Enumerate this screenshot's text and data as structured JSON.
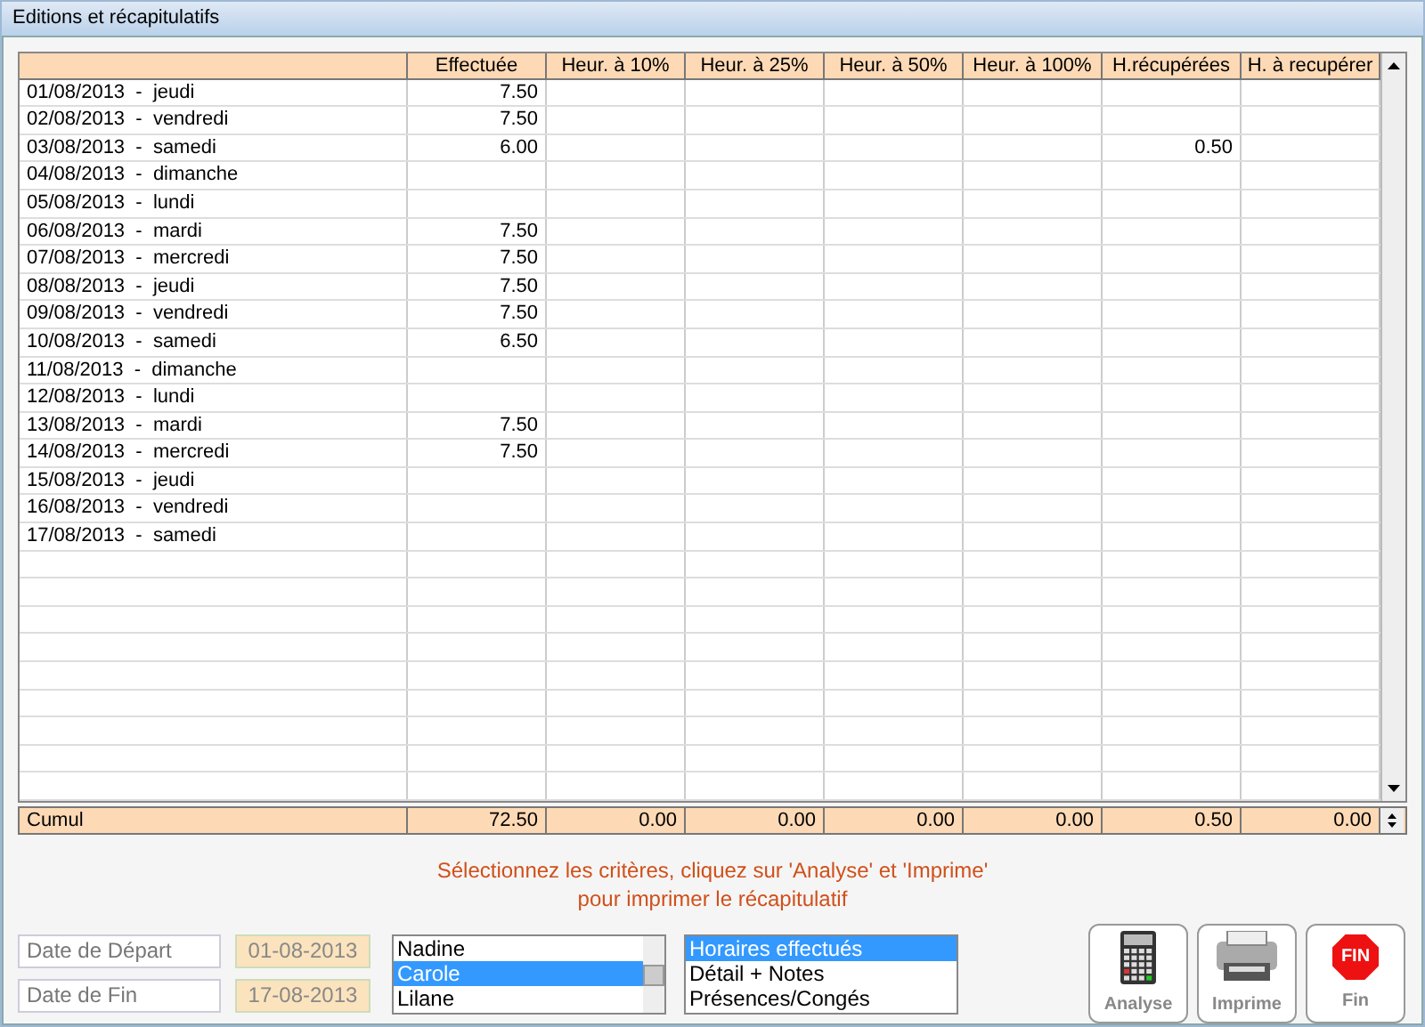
{
  "window": {
    "title": "Editions et récapitulatifs"
  },
  "table": {
    "columns": [
      "",
      "Effectuée",
      "Heur. à 10%",
      "Heur. à 25%",
      "Heur. à 50%",
      "Heur. à 100%",
      "H.récupérées",
      "H. à recupérer"
    ],
    "rows": [
      {
        "label": "01/08/2013  -  jeudi",
        "effectuee": "7.50"
      },
      {
        "label": "02/08/2013  -  vendredi",
        "effectuee": "7.50"
      },
      {
        "label": "03/08/2013  -  samedi",
        "effectuee": "6.00",
        "h_recuperees": "0.50"
      },
      {
        "label": "04/08/2013  -  dimanche"
      },
      {
        "label": "05/08/2013  -  lundi"
      },
      {
        "label": "06/08/2013  -  mardi",
        "effectuee": "7.50"
      },
      {
        "label": "07/08/2013  -  mercredi",
        "effectuee": "7.50"
      },
      {
        "label": "08/08/2013  -  jeudi",
        "effectuee": "7.50"
      },
      {
        "label": "09/08/2013  -  vendredi",
        "effectuee": "7.50"
      },
      {
        "label": "10/08/2013  -  samedi",
        "effectuee": "6.50"
      },
      {
        "label": "11/08/2013  -  dimanche"
      },
      {
        "label": "12/08/2013  -  lundi"
      },
      {
        "label": "13/08/2013  -  mardi",
        "effectuee": "7.50"
      },
      {
        "label": "14/08/2013  -  mercredi",
        "effectuee": "7.50"
      },
      {
        "label": "15/08/2013  -  jeudi"
      },
      {
        "label": "16/08/2013  -  vendredi"
      },
      {
        "label": "17/08/2013  -  samedi"
      }
    ],
    "totals": [
      "Cumul",
      "72.50",
      "0.00",
      "0.00",
      "0.00",
      "0.00",
      "0.50",
      "0.00"
    ]
  },
  "instructions": [
    "Sélectionnez les critères, cliquez sur 'Analyse' et 'Imprime'",
    "pour imprimer le récapitulatif"
  ],
  "dates": [
    {
      "label": "Date de Départ",
      "value": "01-08-2013"
    },
    {
      "label": "Date de Fin",
      "value": "17-08-2013"
    }
  ],
  "employees": [
    {
      "name": "Nadine",
      "selected": false
    },
    {
      "name": "Carole",
      "selected": true
    },
    {
      "name": "Lilane",
      "selected": false
    }
  ],
  "reports": [
    {
      "name": "Horaires effectués",
      "selected": true
    },
    {
      "name": "Détail + Notes",
      "selected": false
    },
    {
      "name": "Présences/Congés",
      "selected": false
    }
  ],
  "buttons": [
    {
      "kind": "calculator",
      "label": "Analyse"
    },
    {
      "kind": "printer",
      "label": "Imprime"
    },
    {
      "kind": "stop",
      "label": "Fin",
      "icon_text": "FIN"
    }
  ]
}
